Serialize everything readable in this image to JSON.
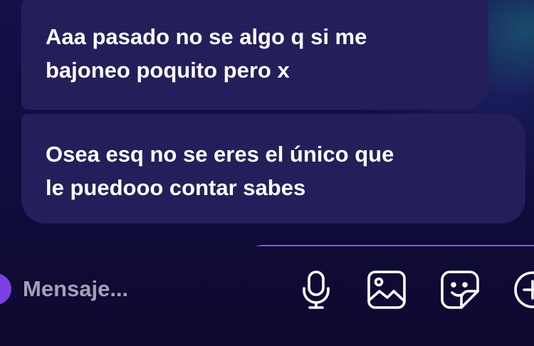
{
  "messages": [
    {
      "lines": [
        "Aaa pasado no se algo q si me",
        "bajoneo poquito pero x"
      ]
    },
    {
      "lines": [
        "Osea esq no se eres el único que",
        "le puedooo contar sabes"
      ]
    }
  ],
  "composer": {
    "placeholder": "Mensaje...",
    "icons": [
      "microphone-icon",
      "image-icon",
      "sticker-icon",
      "plus-circle-icon"
    ]
  },
  "colors": {
    "background": "#100c3c",
    "bubble": "#241f5a",
    "text": "#ffffff",
    "placeholder": "#a3a1b8",
    "accent": "#7b3fe4",
    "icon": "#ffffff"
  }
}
